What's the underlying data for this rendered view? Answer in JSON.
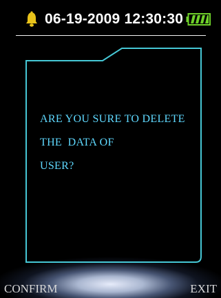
{
  "status_bar": {
    "datetime": "06-19-2009 12:30:30",
    "alarm_icon": "bell-icon",
    "battery_icon": "battery-full-icon",
    "colors": {
      "bell": "#e8c21a",
      "battery": "#6fd12a",
      "text": "#ffffff"
    }
  },
  "dialog": {
    "lines": [
      "ARE YOU SURE TO DELETE",
      "THE  DATA OF",
      "USER?"
    ],
    "text_color": "#5fd9ff",
    "border_color": "#46c8d6"
  },
  "softkeys": {
    "left_label": "CONFIRM",
    "right_label": "EXIT"
  }
}
